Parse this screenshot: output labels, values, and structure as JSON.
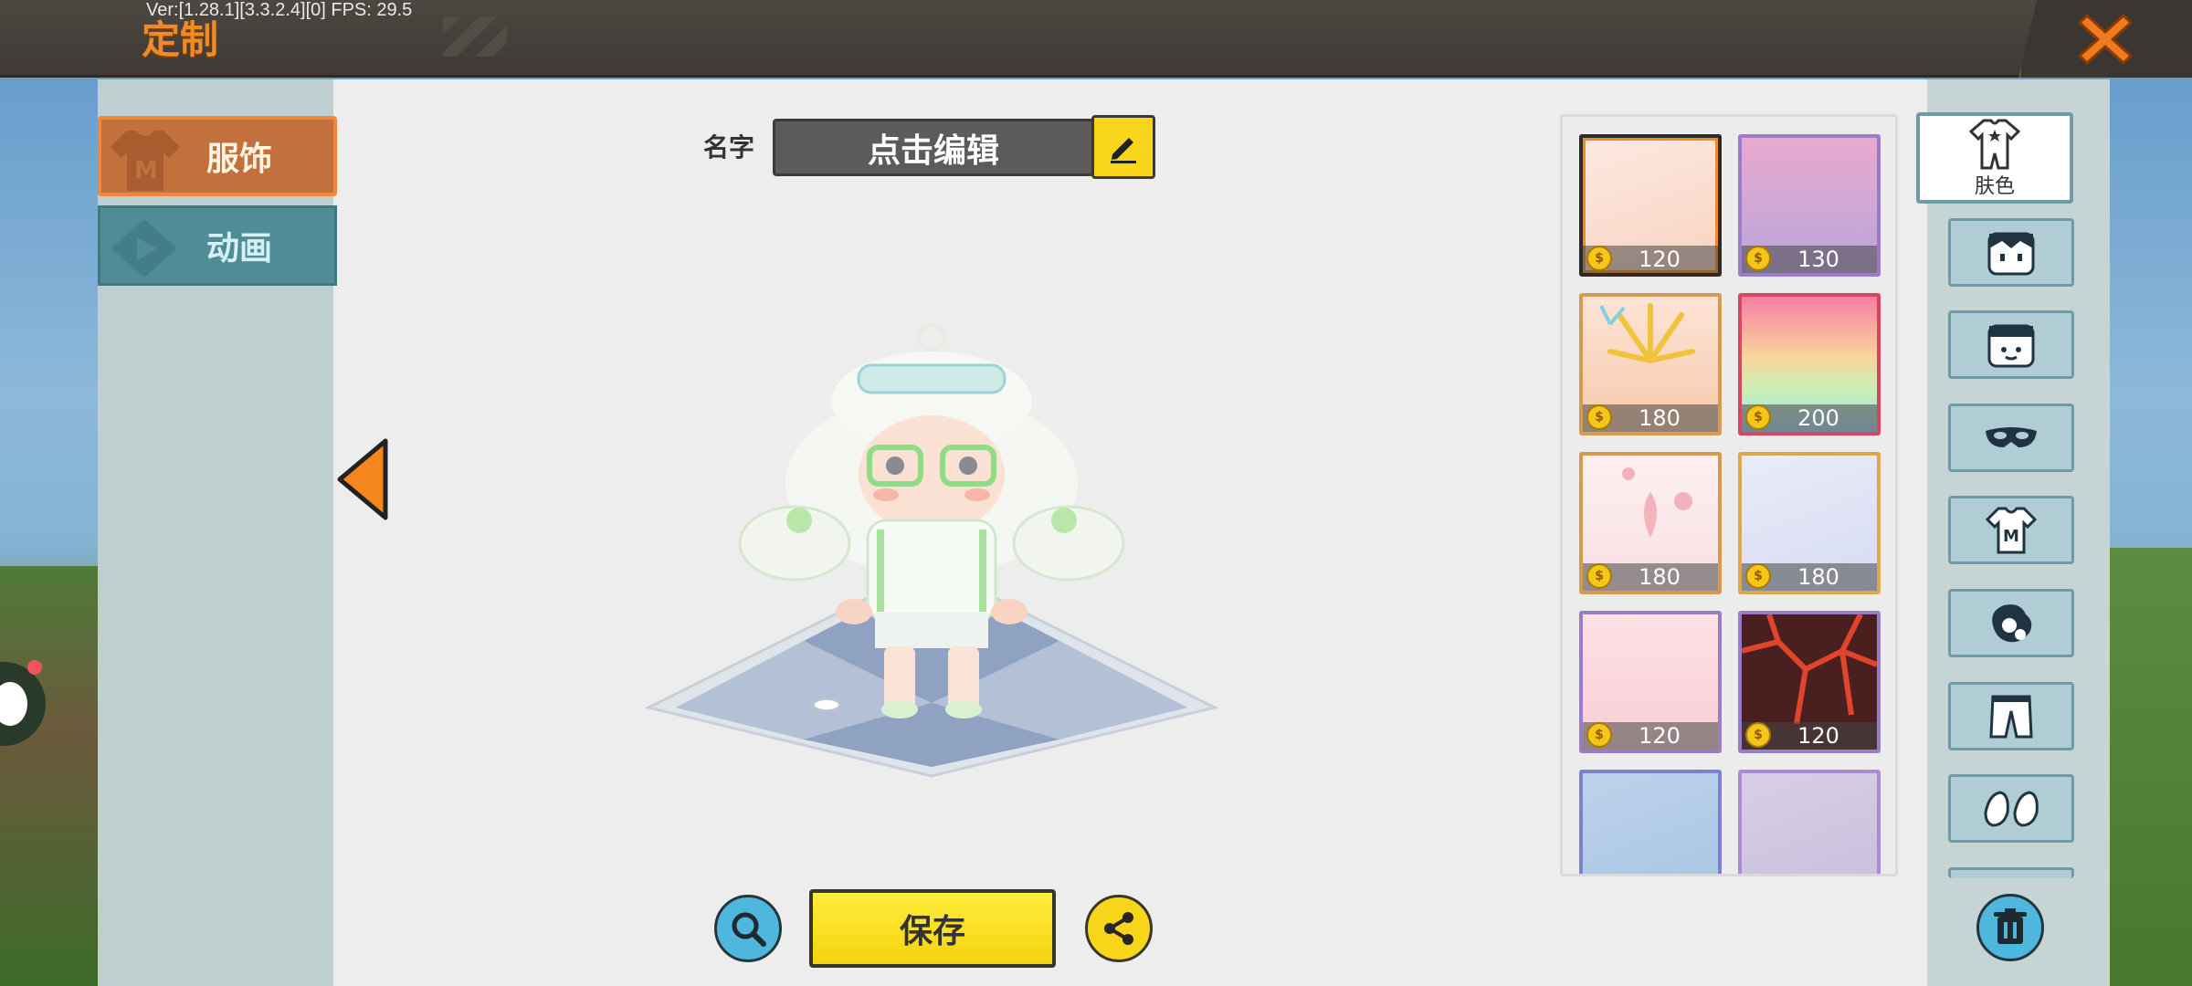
{
  "header": {
    "title": "定制",
    "version_text": "Ver:[1.28.1][3.3.2.4][0] FPS: 29.5"
  },
  "left_tabs": [
    {
      "label": "服饰",
      "selected": true
    },
    {
      "label": "动画",
      "selected": false
    }
  ],
  "name_row": {
    "label": "名字",
    "value": "点击编辑"
  },
  "actions": {
    "save_label": "保存"
  },
  "skin_grid": {
    "items": [
      {
        "price": "120",
        "selected": true
      },
      {
        "price": "130",
        "selected": false
      },
      {
        "price": "180",
        "selected": false
      },
      {
        "price": "200",
        "selected": false
      },
      {
        "price": "180",
        "selected": false
      },
      {
        "price": "180",
        "selected": false
      },
      {
        "price": "120",
        "selected": false
      },
      {
        "price": "120",
        "selected": false
      },
      {
        "price": "",
        "selected": false
      },
      {
        "price": "",
        "selected": false
      }
    ]
  },
  "categories": {
    "skin_label": "肤色",
    "icons": [
      "outfit-icon",
      "face-icon",
      "head-icon",
      "mask-icon",
      "shirt-icon",
      "glove-icon",
      "pants-icon",
      "shoes-icon"
    ]
  },
  "colors": {
    "accent_orange": "#f08a25",
    "save_yellow": "#f6d51b",
    "teal_tab": "#4f8c98",
    "topbar": "#3e3a35"
  }
}
